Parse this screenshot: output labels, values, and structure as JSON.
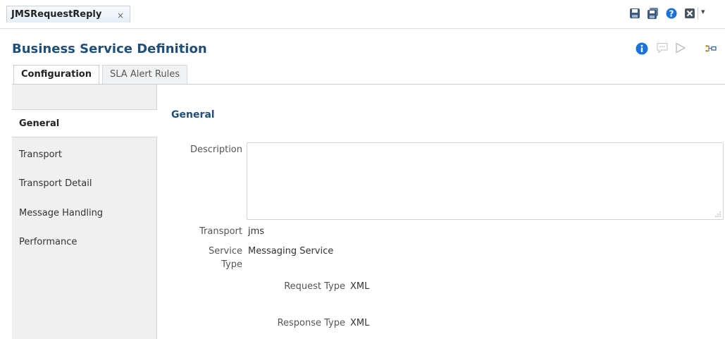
{
  "editor_tab": {
    "label": "JMSRequestReply",
    "close": "×"
  },
  "toolbar": {
    "menu_arrow": "▾"
  },
  "page_title": "Business Service Definition",
  "tabs": [
    {
      "label": "Configuration",
      "active": true
    },
    {
      "label": "SLA Alert Rules",
      "active": false
    }
  ],
  "nav": {
    "items": [
      "General",
      "Transport",
      "Transport Detail",
      "Message Handling",
      "Performance"
    ],
    "selected": "General"
  },
  "general": {
    "section_title": "General",
    "description_label": "Description",
    "description_value": "",
    "transport_label": "Transport",
    "transport_value": "jms",
    "service_type_label_1": "Service",
    "service_type_label_2": "Type",
    "service_type_value": "Messaging Service",
    "request_type_label": "Request Type",
    "request_type_value": "XML",
    "response_type_label": "Response Type",
    "response_type_value": "XML"
  },
  "colors": {
    "title": "#1f4e79",
    "info_icon": "#1a73d9",
    "nav_bg": "#f0f0f0"
  }
}
